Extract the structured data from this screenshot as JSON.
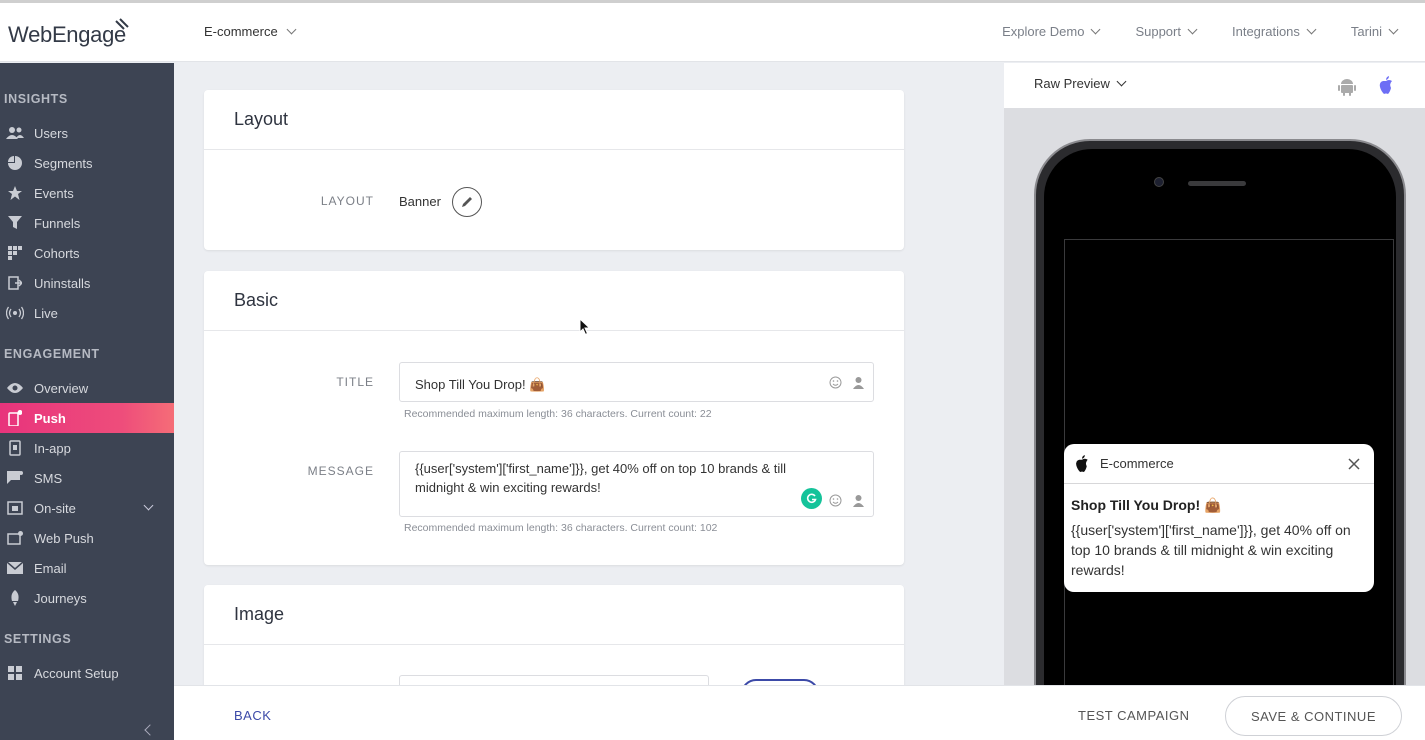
{
  "brand": {
    "logo_text": "WebEngage"
  },
  "header": {
    "project": "E-commerce",
    "nav": [
      "Explore Demo",
      "Support",
      "Integrations",
      "Tarini"
    ]
  },
  "sidebar": {
    "sections": [
      {
        "title": "INSIGHTS",
        "items": [
          {
            "label": "Users",
            "icon": "users-icon"
          },
          {
            "label": "Segments",
            "icon": "segments-icon"
          },
          {
            "label": "Events",
            "icon": "events-icon"
          },
          {
            "label": "Funnels",
            "icon": "funnels-icon"
          },
          {
            "label": "Cohorts",
            "icon": "cohorts-icon"
          },
          {
            "label": "Uninstalls",
            "icon": "uninstalls-icon"
          },
          {
            "label": "Live",
            "icon": "live-icon"
          }
        ]
      },
      {
        "title": "ENGAGEMENT",
        "items": [
          {
            "label": "Overview",
            "icon": "eye-icon"
          },
          {
            "label": "Push",
            "icon": "push-icon",
            "active": true
          },
          {
            "label": "In-app",
            "icon": "in-app-icon"
          },
          {
            "label": "SMS",
            "icon": "sms-icon"
          },
          {
            "label": "On-site",
            "icon": "on-site-icon"
          },
          {
            "label": "Web Push",
            "icon": "web-push-icon"
          },
          {
            "label": "Email",
            "icon": "email-icon"
          },
          {
            "label": "Journeys",
            "icon": "journeys-icon"
          }
        ]
      },
      {
        "title": "SETTINGS",
        "items": [
          {
            "label": "Account Setup",
            "icon": "account-setup-icon"
          }
        ]
      }
    ]
  },
  "layout_card": {
    "title": "Layout",
    "field_label": "LAYOUT",
    "value": "Banner"
  },
  "basic_card": {
    "title": "Basic",
    "title_label": "TITLE",
    "title_value": "Shop Till You Drop! 👜",
    "title_hint": "Recommended maximum length: 36 characters. Current count: 22",
    "message_label": "MESSAGE",
    "message_value": "{{user['system']['first_name']}}, get 40% off on top 10 brands & till midnight & win exciting rewards!",
    "message_hint": "Recommended maximum length: 36 characters. Current count: 102"
  },
  "image_card": {
    "title": "Image"
  },
  "footer": {
    "back": "BACK",
    "test": "TEST CAMPAIGN",
    "save": "SAVE & CONTINUE"
  },
  "preview": {
    "mode": "Raw Preview",
    "app_name": "E-commerce",
    "title": "Shop Till You Drop! 👜",
    "message": "{{user['system']['first_name']}}, get 40% off on top 10 brands & till midnight & win exciting rewards!"
  },
  "colors": {
    "active_push": "#e8347c",
    "sidebar_bg": "#3d4453",
    "link_blue": "#3c4aa8",
    "apple_active": "#6d6ef5"
  }
}
